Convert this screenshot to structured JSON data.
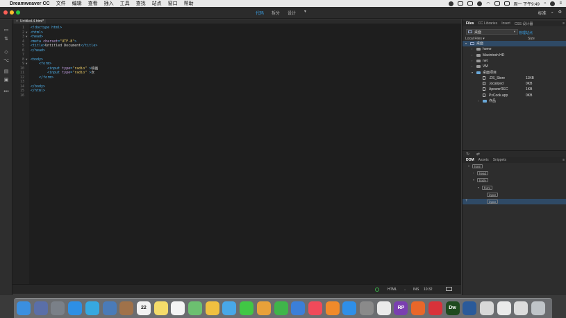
{
  "menubar": {
    "app_name": "Dreamweaver CC",
    "items": [
      "文件",
      "编辑",
      "查看",
      "插入",
      "工具",
      "查找",
      "站点",
      "窗口",
      "帮助"
    ],
    "clock": "周一 下午9:49"
  },
  "titlebar": {
    "view_tabs": [
      "代码",
      "拆分",
      "设计"
    ],
    "active_view": "代码",
    "workspace": "标准"
  },
  "document": {
    "tab_label": "Untitled-4.html*"
  },
  "code": {
    "lines": [
      {
        "n": "1",
        "fold": "",
        "parts": [
          [
            "tag",
            "<!doctype html>"
          ]
        ]
      },
      {
        "n": "2",
        "fold": "▼",
        "parts": [
          [
            "tag",
            "<html>"
          ]
        ]
      },
      {
        "n": "3",
        "fold": "▼",
        "parts": [
          [
            "tag",
            "<head>"
          ]
        ]
      },
      {
        "n": "4",
        "fold": "",
        "parts": [
          [
            "tag",
            "<meta "
          ],
          [
            "attr",
            "charset"
          ],
          [
            "tag",
            "="
          ],
          [
            "str",
            "\"UTF-8\""
          ],
          [
            "tag",
            ">"
          ]
        ]
      },
      {
        "n": "5",
        "fold": "",
        "parts": [
          [
            "tag",
            "<title>"
          ],
          [
            "plain",
            "Untitled Document"
          ],
          [
            "tag",
            "</title>"
          ]
        ]
      },
      {
        "n": "6",
        "fold": "",
        "parts": [
          [
            "tag",
            "</head>"
          ]
        ]
      },
      {
        "n": "7",
        "fold": "",
        "parts": []
      },
      {
        "n": "8",
        "fold": "▼",
        "parts": [
          [
            "tag",
            "<body>"
          ]
        ]
      },
      {
        "n": "9",
        "fold": "▼",
        "parts": [
          [
            "plain",
            "    "
          ],
          [
            "tag",
            "<form>"
          ]
        ]
      },
      {
        "n": "10",
        "fold": "",
        "parts": [
          [
            "plain",
            "        "
          ],
          [
            "tag",
            "<input "
          ],
          [
            "attr",
            "type"
          ],
          [
            "tag",
            "="
          ],
          [
            "str",
            "\"radio\""
          ],
          [
            "tag",
            " >"
          ],
          [
            "plain",
            "绘画"
          ]
        ]
      },
      {
        "n": "11",
        "fold": "",
        "parts": [
          [
            "plain",
            "        "
          ],
          [
            "tag",
            "<input "
          ],
          [
            "attr",
            "type"
          ],
          [
            "tag",
            "="
          ],
          [
            "str",
            "\"radio\""
          ],
          [
            "tag",
            " >"
          ],
          [
            "plain",
            "女"
          ]
        ]
      },
      {
        "n": "12",
        "fold": "",
        "parts": [
          [
            "plain",
            "    "
          ],
          [
            "tag",
            "</form>"
          ]
        ]
      },
      {
        "n": "13",
        "fold": "",
        "parts": []
      },
      {
        "n": "14",
        "fold": "",
        "parts": [
          [
            "tag",
            "</body>"
          ]
        ]
      },
      {
        "n": "15",
        "fold": "",
        "parts": [
          [
            "tag",
            "</html>"
          ]
        ]
      },
      {
        "n": "16",
        "fold": "",
        "parts": []
      }
    ]
  },
  "statusbar": {
    "language": "HTML",
    "mode": "INS",
    "position": "10:32"
  },
  "files_panel": {
    "tabs": [
      "Files",
      "CC Libraries",
      "Insert",
      "CSS 设计器"
    ],
    "active_tab": "Files",
    "site": "桌面",
    "manage_link": "管理站点",
    "col_local": "Local Files ▾",
    "col_size": "Size",
    "tree": [
      {
        "label": "桌面",
        "size": "",
        "icon": "monitor",
        "tw": "▾",
        "depth": 0,
        "sel": true
      },
      {
        "label": "home",
        "size": "",
        "icon": "drive",
        "tw": "›",
        "depth": 1
      },
      {
        "label": "Macintosh HD",
        "size": "",
        "icon": "drive",
        "tw": "›",
        "depth": 1
      },
      {
        "label": "net",
        "size": "",
        "icon": "drive",
        "tw": "›",
        "depth": 1
      },
      {
        "label": "VM",
        "size": "",
        "icon": "drive",
        "tw": "›",
        "depth": 1
      },
      {
        "label": "桌面项目",
        "size": "",
        "icon": "folder",
        "tw": "▾",
        "depth": 1
      },
      {
        "label": ".DS_Store",
        "size": "11KB",
        "icon": "file",
        "tw": "",
        "depth": 2
      },
      {
        "label": ".localized",
        "size": "0KB",
        "icon": "file",
        "tw": "",
        "depth": 2
      },
      {
        "label": "ApowerREC",
        "size": "1KB",
        "icon": "file",
        "tw": "",
        "depth": 2
      },
      {
        "label": "PxCook.app",
        "size": "0KB",
        "icon": "file",
        "tw": "",
        "depth": 2
      },
      {
        "label": "作品",
        "size": "",
        "icon": "folder",
        "tw": "›",
        "depth": 2
      }
    ]
  },
  "dom_panel": {
    "tabs": [
      "DOM",
      "Assets",
      "Snippets"
    ],
    "active_tab": "DOM",
    "nodes": [
      {
        "label": "html",
        "depth": 0,
        "tw": "▾"
      },
      {
        "label": "head",
        "depth": 1,
        "tw": "›"
      },
      {
        "label": "body",
        "depth": 1,
        "tw": "▾"
      },
      {
        "label": "form",
        "depth": 2,
        "tw": "▾"
      },
      {
        "label": "input",
        "depth": 3,
        "tw": ""
      },
      {
        "label": "input",
        "depth": 3,
        "tw": "",
        "sel": true
      }
    ]
  },
  "dock": {
    "apps": [
      {
        "name": "finder",
        "color": "#3b8fe0",
        "label": ""
      },
      {
        "name": "launchpad",
        "color": "#5a6fa8",
        "label": ""
      },
      {
        "name": "rocket",
        "color": "#7a8088",
        "label": ""
      },
      {
        "name": "safari",
        "color": "#2d8fe5",
        "label": ""
      },
      {
        "name": "telegram",
        "color": "#36a8e0",
        "label": ""
      },
      {
        "name": "preview",
        "color": "#4a7bb8",
        "label": ""
      },
      {
        "name": "notes-brown",
        "color": "#a0724a",
        "label": ""
      },
      {
        "name": "calendar",
        "color": "#f2f2f2",
        "label": "22"
      },
      {
        "name": "notes",
        "color": "#f5dc6a",
        "label": ""
      },
      {
        "name": "reminders",
        "color": "#f4f4f4",
        "label": ""
      },
      {
        "name": "maps",
        "color": "#6cc070",
        "label": ""
      },
      {
        "name": "photos",
        "color": "#f0c040",
        "label": ""
      },
      {
        "name": "messages-blue",
        "color": "#48a8e8",
        "label": ""
      },
      {
        "name": "messages",
        "color": "#41c745",
        "label": ""
      },
      {
        "name": "pages",
        "color": "#e8a13a",
        "label": ""
      },
      {
        "name": "numbers",
        "color": "#3fb54a",
        "label": ""
      },
      {
        "name": "keynote",
        "color": "#3b7fd8",
        "label": ""
      },
      {
        "name": "music",
        "color": "#f04a5a",
        "label": ""
      },
      {
        "name": "books",
        "color": "#f08a2a",
        "label": ""
      },
      {
        "name": "app-store",
        "color": "#2f8fe8",
        "label": ""
      },
      {
        "name": "system-prefs",
        "color": "#8a8a8a",
        "label": ""
      },
      {
        "name": "baidu-pan",
        "color": "#eaeaea",
        "label": ""
      },
      {
        "name": "axure-rp",
        "color": "#7a3fb0",
        "label": "RP"
      },
      {
        "name": "firefox",
        "color": "#e8672a",
        "label": ""
      },
      {
        "name": "xmind",
        "color": "#d8323a",
        "label": ""
      },
      {
        "name": "dreamweaver",
        "color": "#1e4a1e",
        "label": "Dw"
      },
      {
        "name": "quicktime",
        "color": "#2a5a9a",
        "label": ""
      },
      {
        "name": "screenshot",
        "color": "#d8d8d8",
        "label": ""
      },
      {
        "name": "keyboard",
        "color": "#eaeaea",
        "label": ""
      },
      {
        "name": "screen",
        "color": "#dcdcdc",
        "label": ""
      },
      {
        "name": "trash",
        "color": "#bfc4c8",
        "label": ""
      }
    ]
  }
}
